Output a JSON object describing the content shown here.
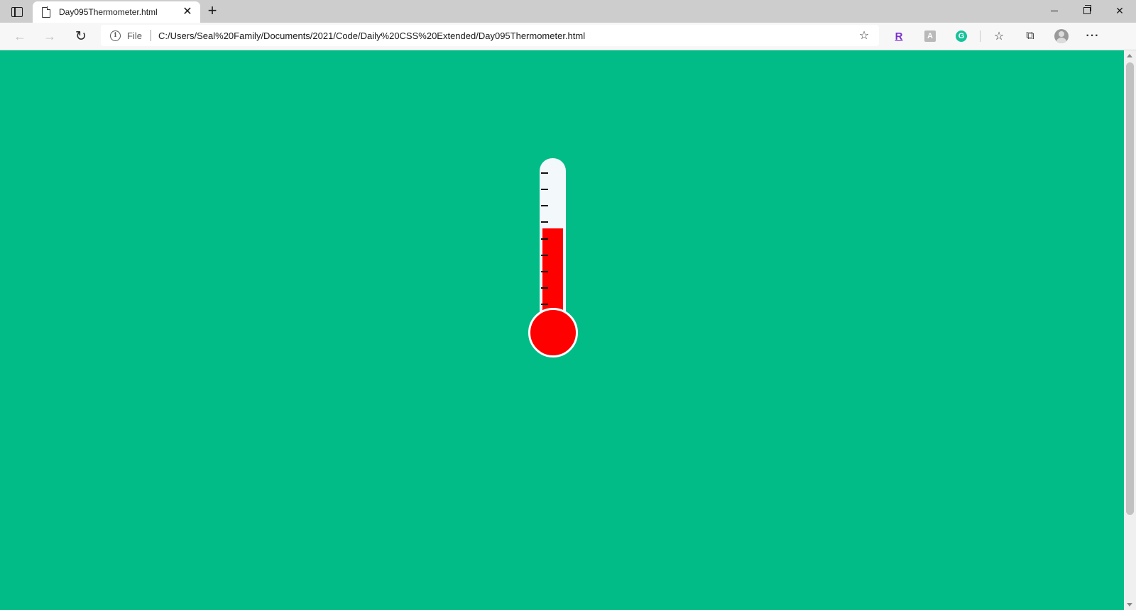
{
  "browser": {
    "tab": {
      "title": "Day095Thermometer.html",
      "close_glyph": "✕",
      "icon": "page-icon"
    },
    "new_tab_glyph": "+",
    "window_controls": {
      "close_glyph": "✕"
    },
    "toolbar": {
      "back_glyph": "←",
      "forward_glyph": "→",
      "refresh_glyph": "↻",
      "address": {
        "scheme_label": "File",
        "url": "C:/Users/Seal%20Family/Documents/2021/Code/Daily%20CSS%20Extended/Day095Thermometer.html",
        "info_glyph": "i",
        "favorite_add_glyph": "☆"
      },
      "extensions": {
        "r_label": "R",
        "square_label": "A",
        "grammarly_label": "G"
      },
      "favorites_glyph": "☆",
      "collections_glyph": "⧉",
      "more_glyph": "···"
    }
  },
  "page": {
    "background_color": "#02bc88",
    "thermometer": {
      "fill_fraction": 0.59,
      "tick_count": 9,
      "mercury_color": "#ff0000",
      "tube_color": "#f3f8fb",
      "tick_color": "#111111"
    }
  }
}
